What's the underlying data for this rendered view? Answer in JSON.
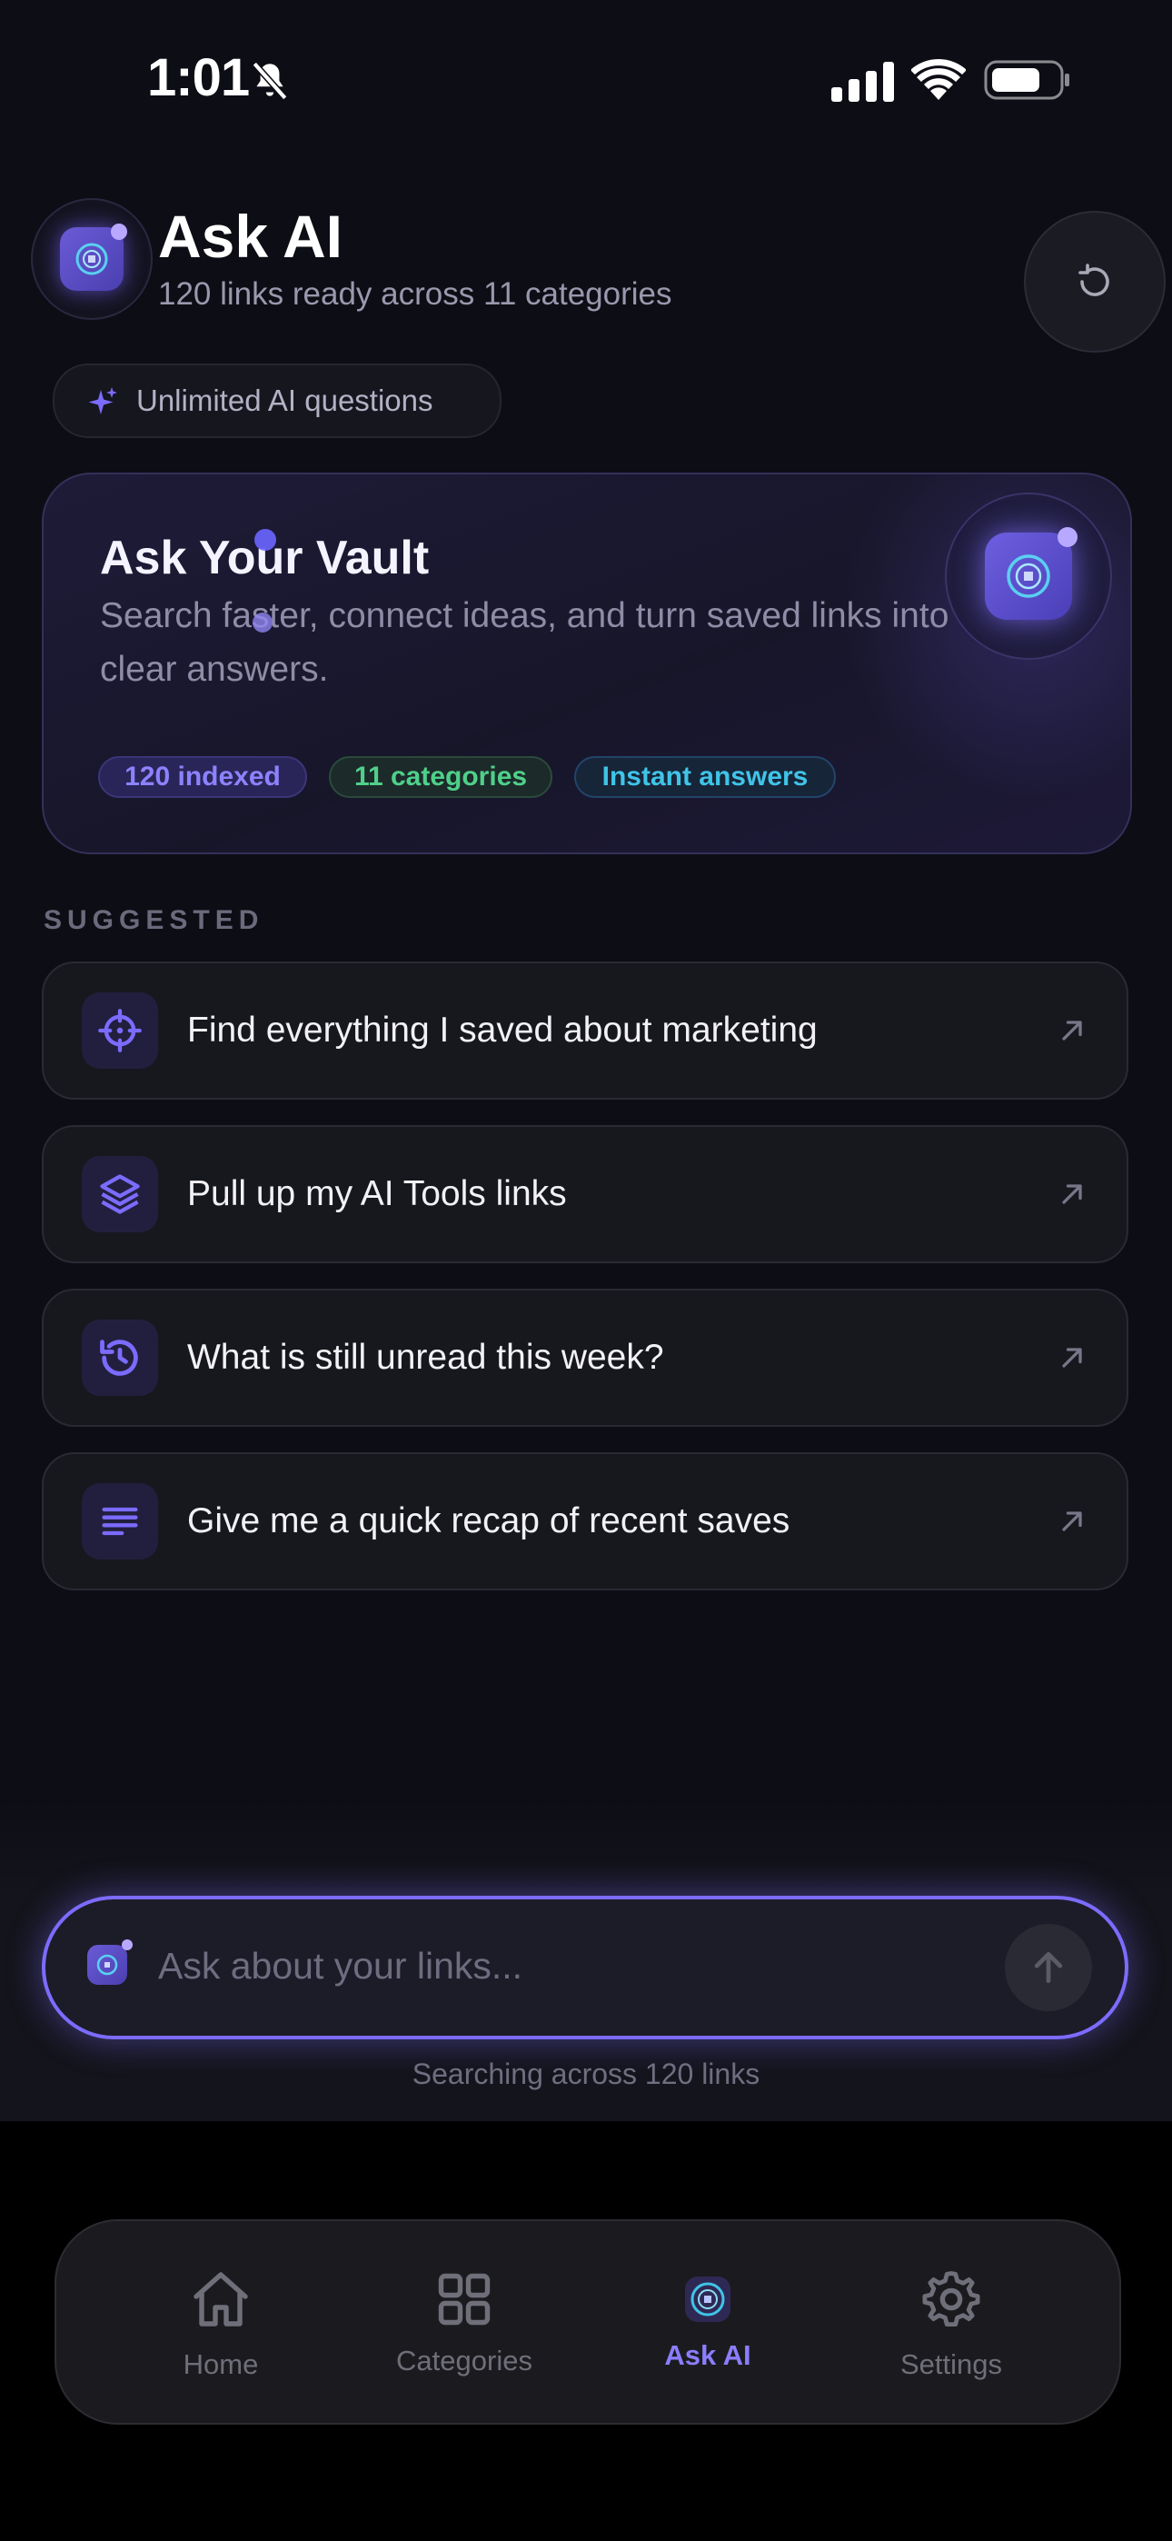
{
  "status_bar": {
    "time": "1:01"
  },
  "header": {
    "title": "Ask AI",
    "subtitle": "120 links ready across 11 categories",
    "pill_label": "Unlimited AI questions"
  },
  "hero": {
    "title": "Ask Your Vault",
    "description": "Search faster, connect ideas, and turn saved links into clear answers.",
    "chips": [
      "120 indexed",
      "11 categories",
      "Instant answers"
    ]
  },
  "suggested": {
    "label": "SUGGESTED",
    "items": [
      {
        "text": "Find everything I saved about marketing",
        "icon": "crosshair-icon"
      },
      {
        "text": "Pull up my AI Tools links",
        "icon": "layers-icon"
      },
      {
        "text": "What is still unread this week?",
        "icon": "history-icon"
      },
      {
        "text": "Give me a quick recap of recent saves",
        "icon": "text-lines-icon"
      }
    ]
  },
  "ask": {
    "placeholder": "Ask about your links...",
    "footnote": "Searching across 120 links"
  },
  "tabs": [
    {
      "label": "Home",
      "icon": "home-icon",
      "active": false
    },
    {
      "label": "Categories",
      "icon": "grid-icon",
      "active": false
    },
    {
      "label": "Ask AI",
      "icon": "ai-target-icon",
      "active": true
    },
    {
      "label": "Settings",
      "icon": "gear-icon",
      "active": false
    }
  ],
  "colors": {
    "accent": "#7c6cff",
    "active_tab": "#8b7dff",
    "background": "#0d0d15"
  }
}
